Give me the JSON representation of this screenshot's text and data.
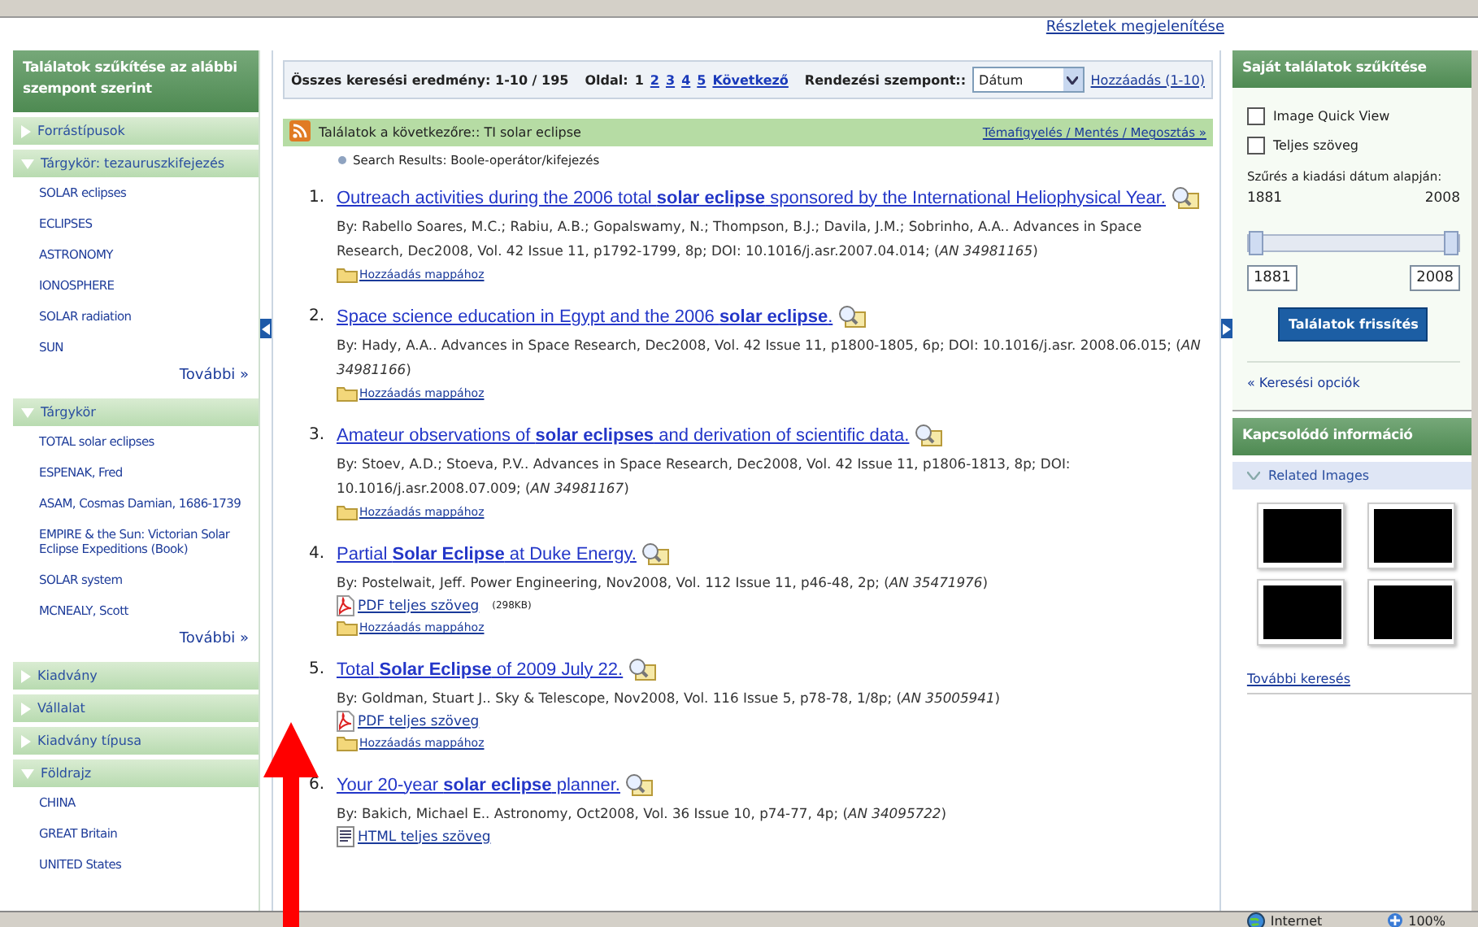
{
  "browser": {
    "top_link": "Részletek megjelenítése",
    "status_bar": {
      "zone": "Internet",
      "zoom": "100%"
    }
  },
  "left_panel": {
    "title": "Találatok szűkítése az alábbi szempont szerint",
    "sections": [
      {
        "label": "Forrástípusok",
        "expanded": false
      },
      {
        "label": "Tárgykör: tezauruszkifejezés",
        "expanded": true,
        "items": [
          "SOLAR eclipses",
          "ECLIPSES",
          "ASTRONOMY",
          "IONOSPHERE",
          "SOLAR radiation",
          "SUN"
        ],
        "more": "További »"
      },
      {
        "label": "Tárgykör",
        "expanded": true,
        "items": [
          "TOTAL solar eclipses",
          "ESPENAK, Fred",
          "ASAM, Cosmas Damian, 1686-1739",
          "EMPIRE & the Sun: Victorian Solar Eclipse Expeditions (Book)",
          "SOLAR system",
          "MCNEALY, Scott"
        ],
        "more": "További »"
      },
      {
        "label": "Kiadvány",
        "expanded": false
      },
      {
        "label": "Vállalat",
        "expanded": false
      },
      {
        "label": "Kiadvány típusa",
        "expanded": false
      },
      {
        "label": "Földrajz",
        "expanded": true,
        "items": [
          "CHINA",
          "GREAT Britain",
          "UNITED States"
        ]
      }
    ]
  },
  "toolbar": {
    "summary": "Összes keresési eredmény: 1-10 / 195",
    "page_label": "Oldal:",
    "pages": [
      {
        "label": "1",
        "selected": true
      },
      {
        "label": "2",
        "selected": false
      },
      {
        "label": "3",
        "selected": false
      },
      {
        "label": "4",
        "selected": false
      },
      {
        "label": "5",
        "selected": false
      }
    ],
    "next": "Következő",
    "sort_label": "Rendezési szempont::",
    "sort_value": "Dátum",
    "add_link": "Hozzáadás (1-10)"
  },
  "results_header": {
    "query": "Találatok a következőre:: TI solar eclipse",
    "link": "Témafigyelés / Mentés / Megosztás »",
    "breadcrumb": "Search Results: Boole-operátor/kifejezés"
  },
  "results": [
    {
      "number": "1.",
      "title": "Outreach activities during the 2006 total **solar eclipse** sponsored by the International Heliophysical Year.",
      "byline": "By: Rabello Soares, M.C.; Rabiu, A.B.; Gopalswamy, N.; Thompson, B.J.; Davila, J.M.; Sobrinho, A.A.. Advances in Space Research, Dec2008, Vol. 42 Issue 11, p1792-1799, 8p; DOI: 10.1016/j.asr.2007.04.014; (*AN 34981165*)",
      "folder_link": "Hozzáadás mappához"
    },
    {
      "number": "2.",
      "title": "Space science education in Egypt and the 2006 **solar eclipse**.",
      "byline": "By: Hady, A.A.. Advances in Space Research, Dec2008, Vol. 42 Issue 11, p1800-1805, 6p; DOI: 10.1016/j.asr. 2008.06.015; (*AN 34981166*)",
      "folder_link": "Hozzáadás mappához"
    },
    {
      "number": "3.",
      "title": "Amateur observations of **solar eclipses** and derivation of scientific data.",
      "byline": "By: Stoev, A.D.; Stoeva, P.V.. Advances in Space Research, Dec2008, Vol. 42 Issue 11, p1806-1813, 8p; DOI: 10.1016/j.asr.2008.07.009; (*AN 34981167*)",
      "folder_link": "Hozzáadás mappához"
    },
    {
      "number": "4.",
      "title": "Partial **Solar Eclipse** at Duke Energy.",
      "byline": "By: Postelwait, Jeff. Power Engineering, Nov2008, Vol. 112 Issue 11, p46-48, 2p; (*AN 35471976*)",
      "links": [
        {
          "kind": "pdf",
          "label": "PDF teljes szöveg",
          "size": "(298KB)"
        }
      ],
      "folder_link": "Hozzáadás mappához"
    },
    {
      "number": "5.",
      "title": "Total **Solar Eclipse** of 2009 July 22.",
      "byline": "By: Goldman, Stuart J.. Sky & Telescope, Nov2008, Vol. 116 Issue 5, p78-78, 1/8p; (*AN 35005941*)",
      "links": [
        {
          "kind": "pdf",
          "label": "PDF teljes szöveg"
        }
      ],
      "folder_link": "Hozzáadás mappához"
    },
    {
      "number": "6.",
      "title": "Your 20-year **solar eclipse** planner.",
      "byline": "By: Bakich, Michael E.. Astronomy, Oct2008, Vol. 36 Issue 10, p74-77, 4p; (*AN 34095722*)",
      "links": [
        {
          "kind": "html",
          "label": "HTML teljes szöveg"
        }
      ]
    }
  ],
  "right_panel": {
    "title": "Saját találatok szűkítése",
    "checkboxes": [
      {
        "label": "Image Quick View",
        "checked": false
      },
      {
        "label": "Teljes szöveg",
        "checked": false
      }
    ],
    "filter_label": "Szűrés a kiadási dátum alapján:",
    "range_min": "1881",
    "range_max": "2008",
    "slider": {
      "low": {
        "level": 0
      },
      "high": {
        "level": 1
      }
    },
    "from_value": "1881",
    "to_value": "2008",
    "button": "Találatok frissítés",
    "options_link": "« Keresési opciók",
    "related_title": "Kapcsolódó információ",
    "related_images": {
      "label": "Related Images",
      "expanded": true,
      "images": [
        {
          "kind": "photo"
        },
        {
          "kind": "photo"
        },
        {
          "kind": "photo"
        },
        {
          "kind": "photo"
        }
      ]
    },
    "more_search": "További keresés"
  },
  "annotations": [
    {
      "kind": "arrow"
    }
  ]
}
